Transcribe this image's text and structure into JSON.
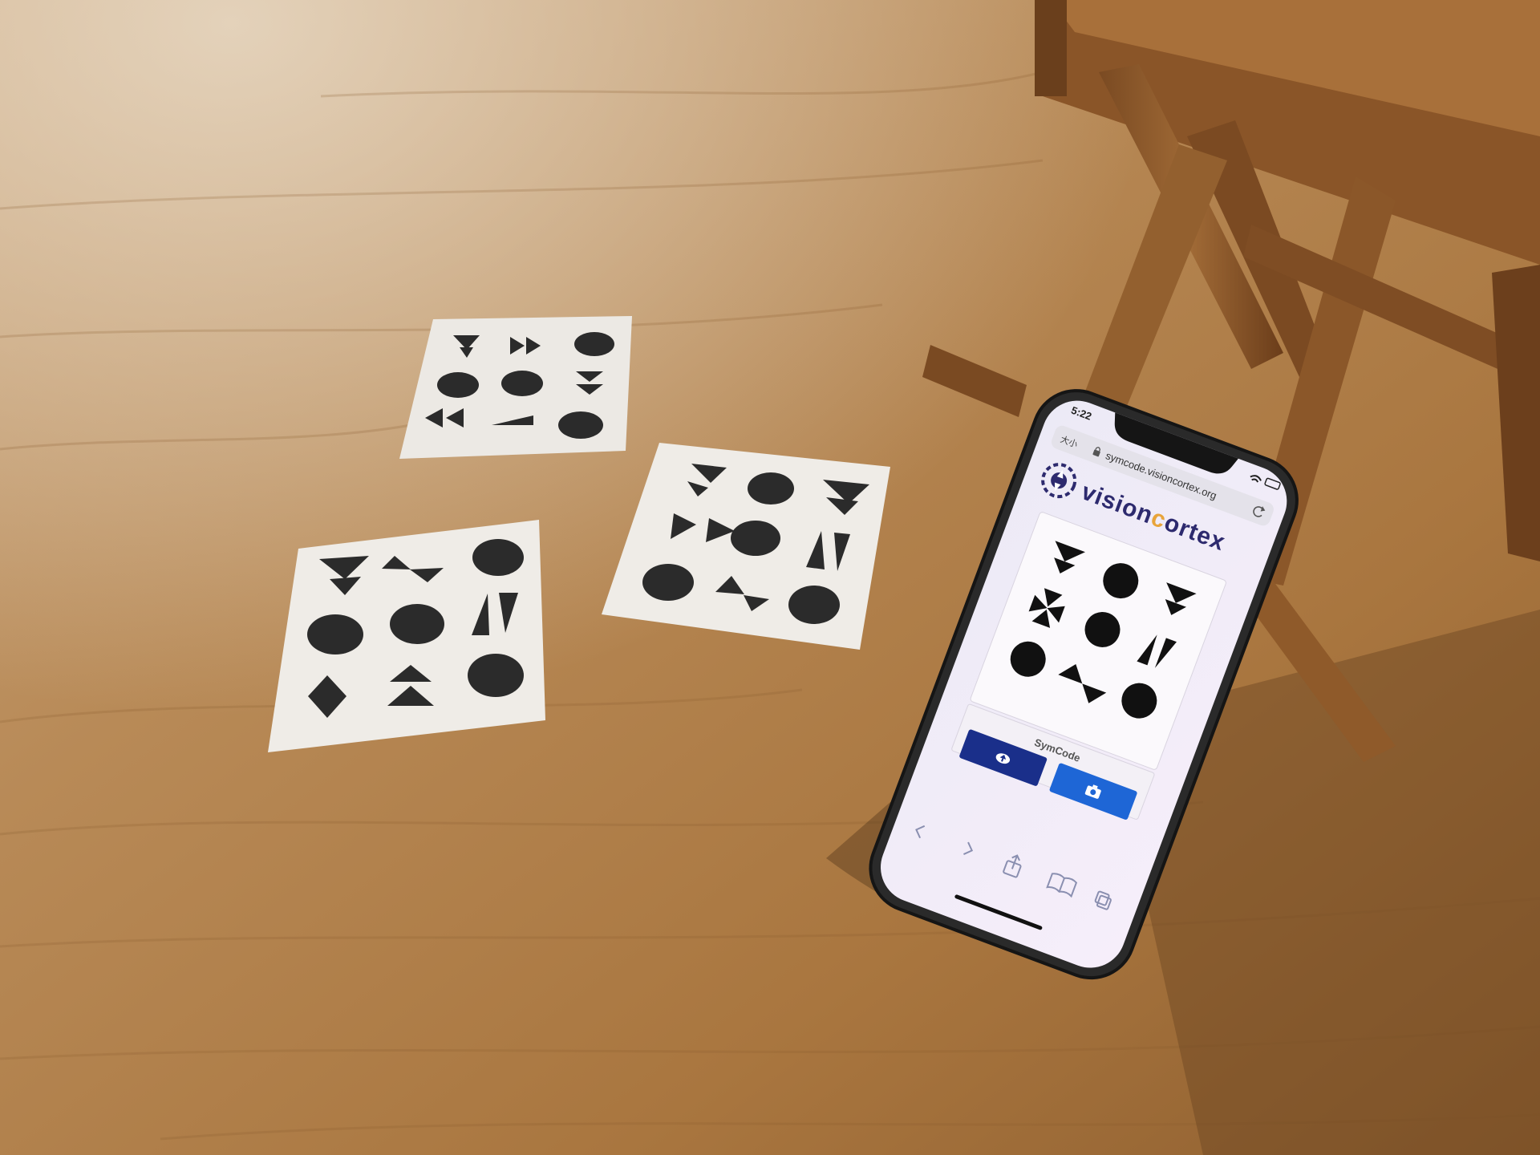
{
  "phone": {
    "status_time": "5:22",
    "text_size_label": "大小",
    "url": "symcode.visioncortex.org",
    "brand": {
      "part1": "visio",
      "part2": "n",
      "part3": "c",
      "part4": "ortex"
    },
    "card_title": "SymCode",
    "colors": {
      "brand_dark": "#2d2a6e",
      "brand_orange": "#e8a43a",
      "upload_button": "#1a2f8a",
      "camera_button": "#1e66d6"
    }
  },
  "icons": [
    "visioncortex-logo-icon",
    "lock-icon",
    "reload-icon",
    "cloud-upload-icon",
    "camera-icon",
    "back-icon",
    "forward-icon",
    "share-icon",
    "bookmarks-icon",
    "tabs-icon"
  ]
}
